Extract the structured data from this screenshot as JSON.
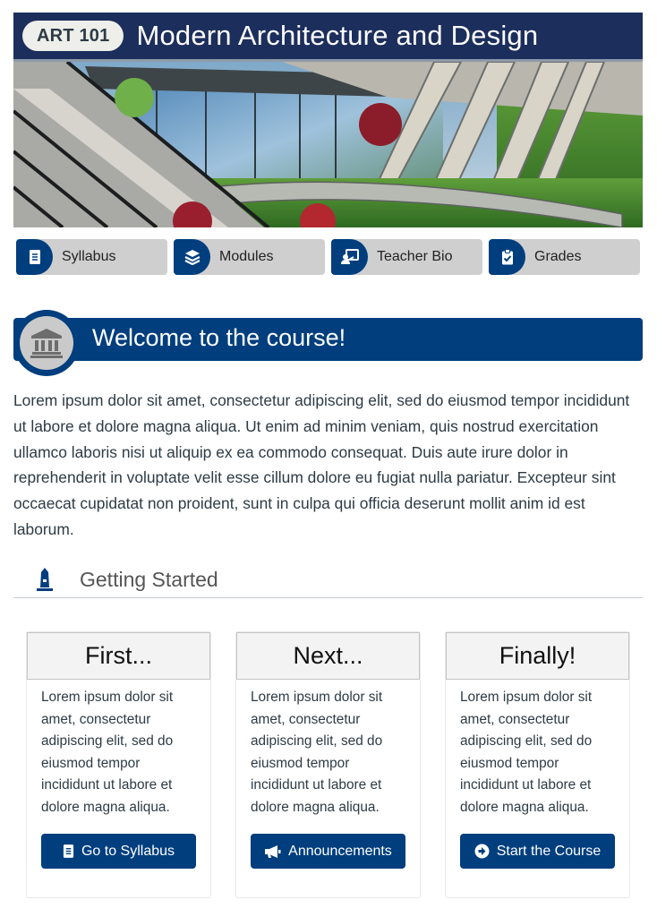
{
  "header": {
    "course_code": "ART 101",
    "course_title": "Modern Architecture and Design",
    "bar_color": "#1c2e5c"
  },
  "banner": {
    "alt": "Modern glass and steel building with curved walkway and trees"
  },
  "nav": [
    {
      "label": "Syllabus",
      "icon": "syllabus-icon"
    },
    {
      "label": "Modules",
      "icon": "layers-icon"
    },
    {
      "label": "Teacher Bio",
      "icon": "teacher-icon"
    },
    {
      "label": "Grades",
      "icon": "clipboard-check-icon"
    }
  ],
  "welcome": {
    "title": "Welcome to the course!",
    "icon": "institution-icon",
    "intro": "Lorem ipsum dolor sit amet, consectetur adipiscing elit, sed do eiusmod tempor incididunt ut labore et dolore magna aliqua. Ut enim ad minim veniam, quis nostrud exercitation ullamco laboris nisi ut aliquip ex ea commodo consequat. Duis aute irure dolor in reprehenderit in voluptate velit esse cillum dolore eu fugiat nulla pariatur. Excepteur sint occaecat cupidatat non proident, sunt in culpa qui officia deserunt mollit anim id est laborum."
  },
  "getting_started": {
    "title": "Getting Started",
    "icon": "monument-icon"
  },
  "cards": [
    {
      "heading": "First...",
      "body": "Lorem ipsum dolor sit amet, consectetur adipiscing elit, sed do eiusmod tempor incididunt ut labore et dolore magna aliqua.",
      "button_label": "Go to Syllabus",
      "button_icon": "syllabus-icon"
    },
    {
      "heading": "Next...",
      "body": "Lorem ipsum dolor sit amet, consectetur adipiscing elit, sed do eiusmod tempor incididunt ut labore et dolore magna aliqua.",
      "button_label": "Announcements",
      "button_icon": "megaphone-icon"
    },
    {
      "heading": "Finally!",
      "body": "Lorem ipsum dolor sit amet, consectetur adipiscing elit, sed do eiusmod tempor incididunt ut labore et dolore magna aliqua.",
      "button_label": "Start the Course",
      "button_icon": "arrow-circle-right-icon"
    }
  ],
  "colors": {
    "primary": "#003e7e",
    "header": "#1c2e5c",
    "nav_bg": "#cfcfcf",
    "text": "#2d3b45"
  }
}
